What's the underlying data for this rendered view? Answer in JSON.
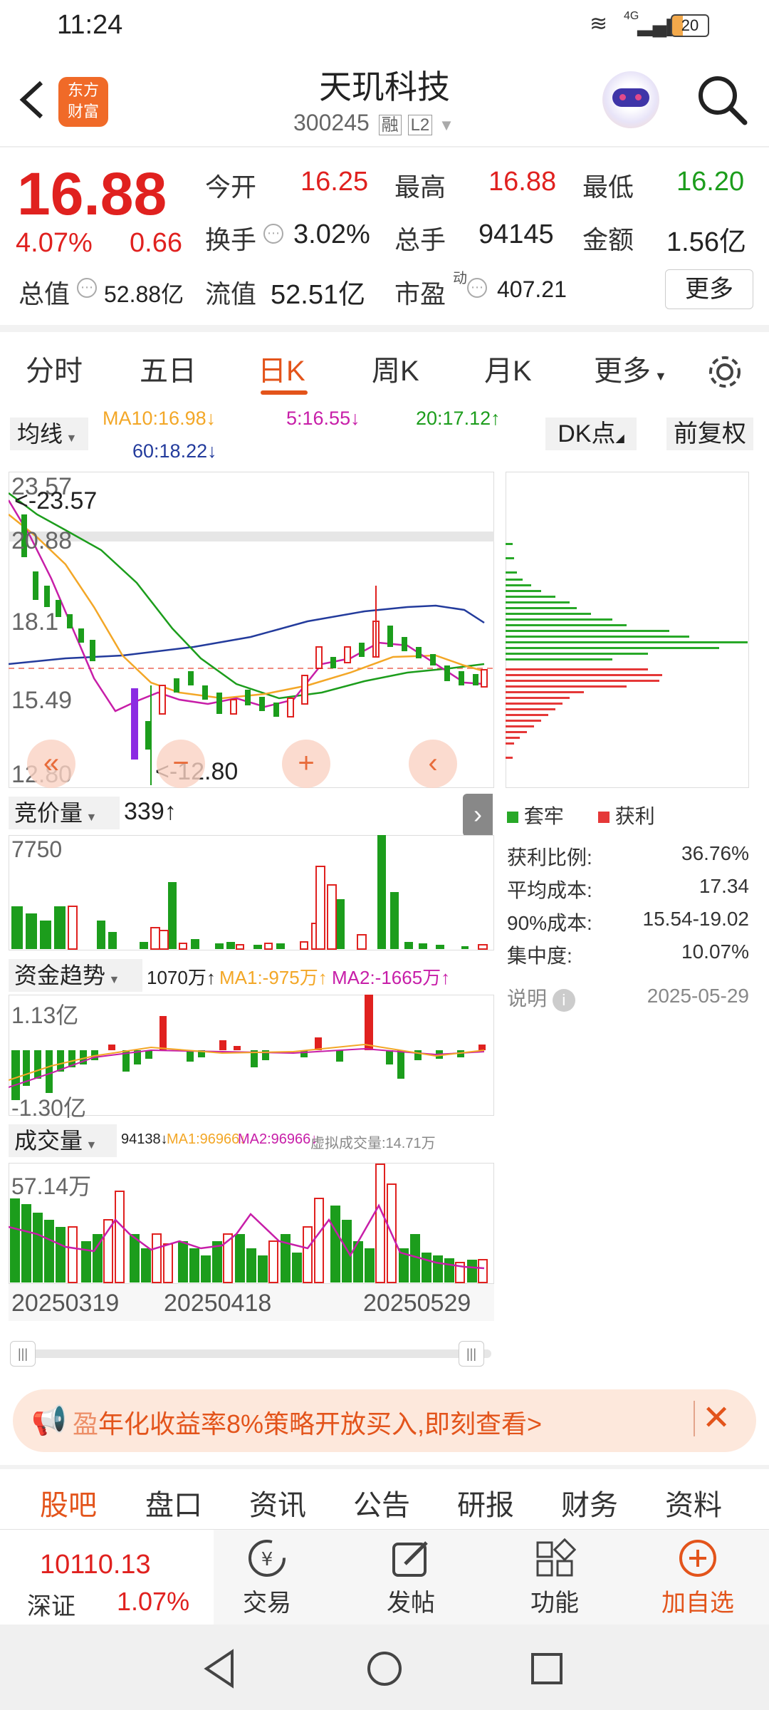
{
  "status": {
    "time": "11:24",
    "network": "4G",
    "battery": "20"
  },
  "header": {
    "logo_line1": "东方",
    "logo_line2": "财富",
    "title": "天玑科技",
    "code": "300245",
    "badge_rong": "融",
    "badge_l2": "L2"
  },
  "quote": {
    "price": "16.88",
    "change_pct": "4.07%",
    "change_amt": "0.66",
    "open_label": "今开",
    "open": "16.25",
    "high_label": "最高",
    "high": "16.88",
    "low_label": "最低",
    "low": "16.20",
    "turnover_label": "换手",
    "turnover": "3.02%",
    "volume_label": "总手",
    "volume": "94145",
    "amount_label": "金额",
    "amount": "1.56亿",
    "mcap_label": "总值",
    "mcap": "52.88亿",
    "float_label": "流值",
    "float": "52.51亿",
    "pe_label": "市盈",
    "pe_sup": "动",
    "pe": "407.21",
    "more": "更多"
  },
  "tabs": [
    "分时",
    "五日",
    "日K",
    "周K",
    "月K",
    "更多"
  ],
  "ma": {
    "selector": "均线",
    "ma10": "MA10:16.98↓",
    "ma5": "5:16.55↓",
    "ma20": "20:17.12↑",
    "ma60": "60:18.22↓",
    "dk": "DK点",
    "fq": "前复权"
  },
  "kline": {
    "ticks": [
      "23.57",
      "20.88",
      "18.1",
      "15.49",
      "12.80"
    ],
    "max_label": "<-23.57",
    "min_label": "<-12.80"
  },
  "chip": {
    "legend_trapped": "套牢",
    "legend_profit": "获利",
    "rows": [
      {
        "k": "获利比例:",
        "v": "36.76%"
      },
      {
        "k": "平均成本:",
        "v": "17.34"
      },
      {
        "k": "90%成本:",
        "v": "15.54-19.02"
      },
      {
        "k": "集中度:",
        "v": "10.07%"
      }
    ],
    "note": "说明",
    "date": "2025-05-29"
  },
  "auction": {
    "selector": "竞价量",
    "value": "339↑",
    "tick": "7750"
  },
  "fund": {
    "selector": "资金趋势",
    "value": "1070万↑",
    "ma1": "MA1:-975万↑",
    "ma2": "MA2:-1665万↑",
    "top": "1.13亿",
    "bottom": "-1.30亿"
  },
  "volume": {
    "selector": "成交量",
    "value": "94138↓",
    "ma1": "MA1:96966↓",
    "ma2": "MA2:96966↓",
    "virtual": "虚拟成交量:14.71万",
    "top": "57.14万"
  },
  "dates": [
    "20250319",
    "20250418",
    "20250529"
  ],
  "banner": {
    "text": "年化收益率8%策略开放买入,即刻查看>",
    "prefix": "盈"
  },
  "subtabs": [
    "股吧",
    "盘口",
    "资讯",
    "公告",
    "研报",
    "财务",
    "资料"
  ],
  "bottom": {
    "index_value": "10110.13",
    "index_name": "深证",
    "index_pct": "1.07%",
    "trade": "交易",
    "post": "发帖",
    "func": "功能",
    "add": "加自选"
  },
  "colors": {
    "accent": "#e3541b",
    "up": "#e0211f",
    "down": "#1c9d1c"
  }
}
